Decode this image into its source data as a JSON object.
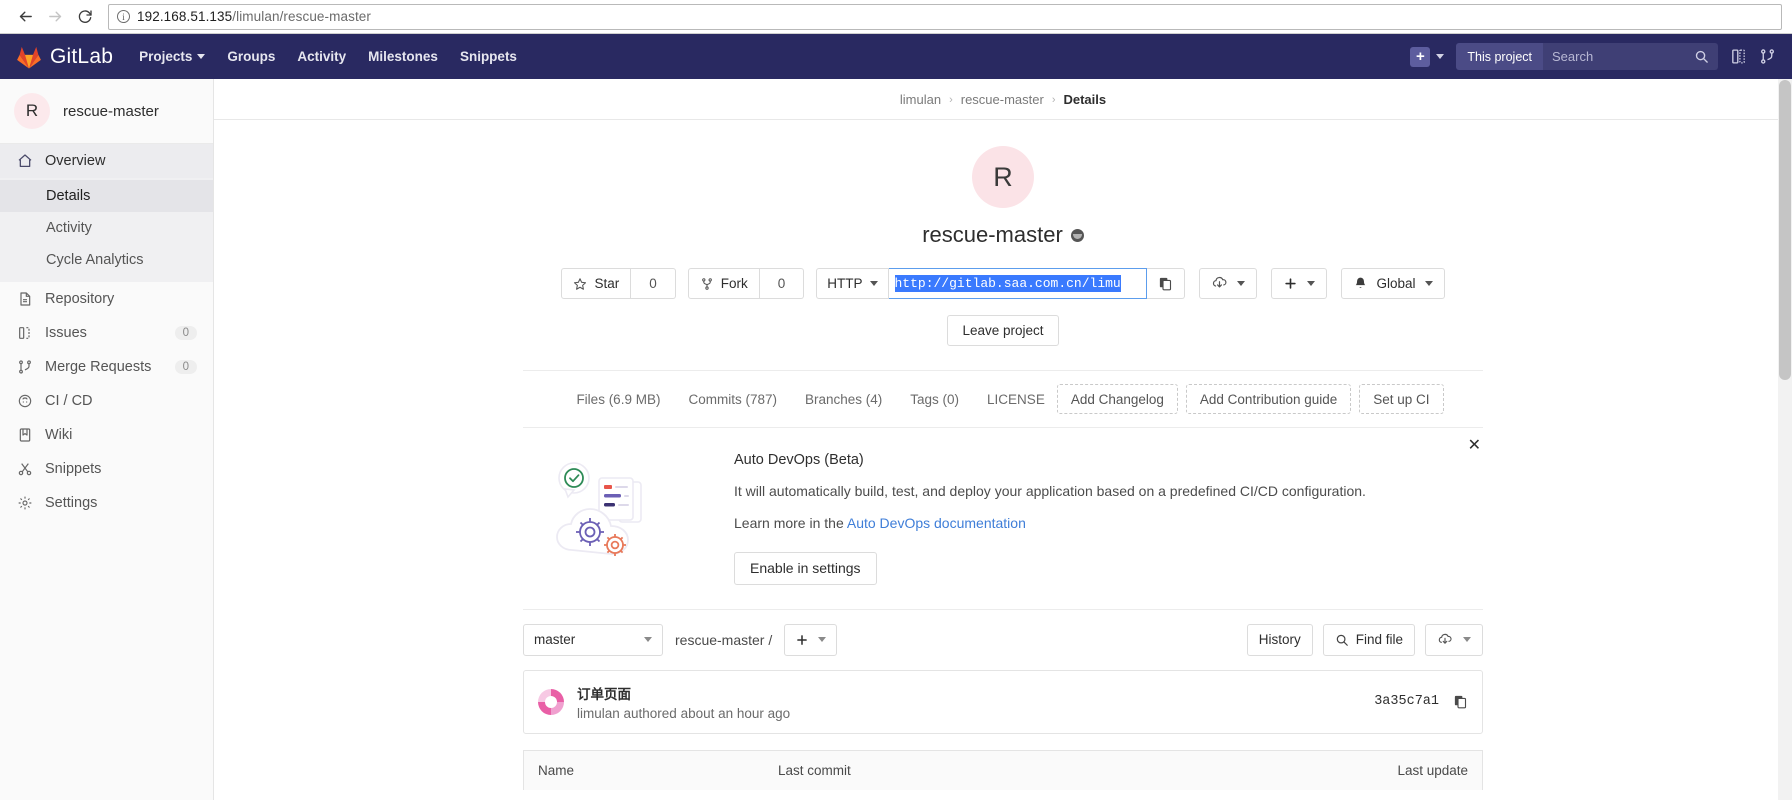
{
  "browser": {
    "back_icon": "arrow-left-icon",
    "forward_icon": "arrow-right-icon",
    "reload_icon": "reload-icon",
    "info_glyph": "i",
    "url_host": "192.168.51.135",
    "url_path": "/limulan/rescue-master"
  },
  "topnav": {
    "brand": "GitLab",
    "links": [
      {
        "label": "Projects",
        "has_caret": true
      },
      {
        "label": "Groups",
        "has_caret": false
      },
      {
        "label": "Activity",
        "has_caret": false
      },
      {
        "label": "Milestones",
        "has_caret": false
      },
      {
        "label": "Snippets",
        "has_caret": false
      }
    ],
    "new_label": "+",
    "search_scope": "This project",
    "search_placeholder": "Search",
    "icons": [
      "issues-board-icon",
      "merge-requests-icon"
    ]
  },
  "sidebar": {
    "project_initial": "R",
    "project_name": "rescue-master",
    "items": [
      {
        "label": "Overview",
        "icon": "home-icon",
        "badge": ""
      },
      {
        "label": "Repository",
        "icon": "doc-icon",
        "badge": ""
      },
      {
        "label": "Issues",
        "icon": "issues-icon",
        "badge": "0"
      },
      {
        "label": "Merge Requests",
        "icon": "merge-icon",
        "badge": "0"
      },
      {
        "label": "CI / CD",
        "icon": "rocket-icon",
        "badge": ""
      },
      {
        "label": "Wiki",
        "icon": "book-icon",
        "badge": ""
      },
      {
        "label": "Snippets",
        "icon": "scissors-icon",
        "badge": ""
      },
      {
        "label": "Settings",
        "icon": "gear-icon",
        "badge": ""
      }
    ],
    "sub_items": [
      {
        "label": "Details",
        "active": true
      },
      {
        "label": "Activity",
        "active": false
      },
      {
        "label": "Cycle Analytics",
        "active": false
      }
    ]
  },
  "breadcrumb": {
    "group": "limulan",
    "project": "rescue-master",
    "current": "Details",
    "separator": "›"
  },
  "project": {
    "initial": "R",
    "name": "rescue-master",
    "visibility_icon": "globe-icon",
    "star_label": "Star",
    "star_count": "0",
    "fork_label": "Fork",
    "fork_count": "0",
    "protocol": "HTTP",
    "clone_url": "http://gitlab.saa.com.cn/limu",
    "copy_icon": "copy-icon",
    "download_icon": "download-icon",
    "plus_icon": "plus-icon",
    "notification_icon": "bell-icon",
    "notification_label": "Global",
    "leave_label": "Leave project"
  },
  "stats": {
    "items": [
      "Files (6.9 MB)",
      "Commits (787)",
      "Branches (4)",
      "Tags (0)",
      "LICENSE"
    ],
    "actions": [
      "Add Changelog",
      "Add Contribution guide",
      "Set up CI"
    ]
  },
  "devops": {
    "title": "Auto DevOps (Beta)",
    "description": "It will automatically build, test, and deploy your application based on a predefined CI/CD configuration.",
    "learn_prefix": "Learn more in the ",
    "learn_link": "Auto DevOps documentation",
    "button": "Enable in settings",
    "close_icon": "close-icon",
    "art_icon": "cloud-gears-illustration"
  },
  "repo": {
    "branch": "master",
    "path": "rescue-master /",
    "add_icon": "plus-icon",
    "history_label": "History",
    "find_file_label": "Find file",
    "find_icon": "search-icon",
    "download_icon": "download-icon"
  },
  "commit": {
    "message": "订单页面",
    "meta": "limulan authored about an hour ago",
    "sha": "3a35c7a1",
    "copy_icon": "copy-icon"
  },
  "file_table": {
    "col_name": "Name",
    "col_last_commit": "Last commit",
    "col_last_update": "Last update"
  },
  "colors": {
    "nav_bg": "#292961",
    "accent_link": "#3f7ed8",
    "selection_blue": "#3a7afe",
    "avatar_pink": "#fbe3e7"
  }
}
